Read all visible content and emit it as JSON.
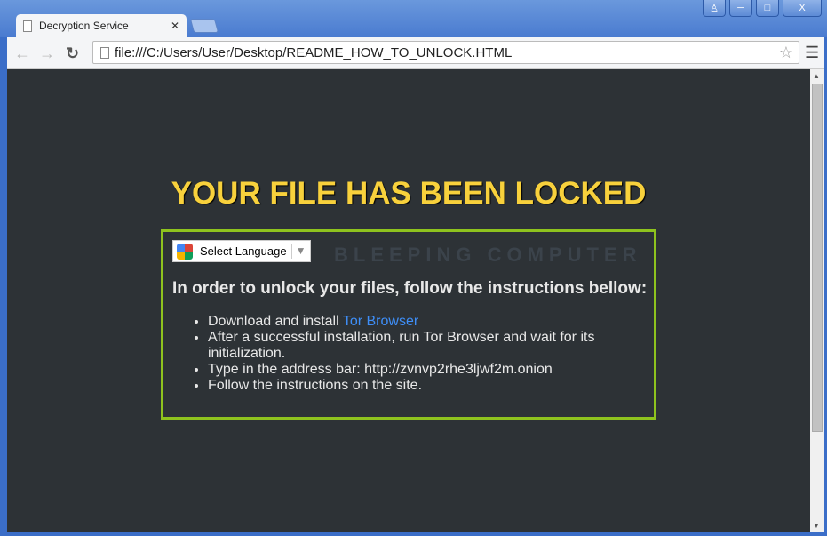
{
  "browser": {
    "tab_title": "Decryption Service",
    "url": "file:///C:/Users/User/Desktop/README_HOW_TO_UNLOCK.HTML"
  },
  "page": {
    "heading": "YOUR FILE HAS BEEN LOCKED",
    "select_language": "Select Language",
    "watermark": "BLEEPING COMPUTER",
    "instructions_title": "In order to unlock your files, follow the instructions bellow:",
    "steps": [
      {
        "text": "Download and install ",
        "link": "Tor Browser"
      },
      {
        "text": "After a successful installation, run Tor Browser and wait for its initialization."
      },
      {
        "text": "Type in the address bar: http://zvnvp2rhe3ljwf2m.onion"
      },
      {
        "text": "Follow the instructions on the site."
      }
    ]
  },
  "colors": {
    "heading": "#f8d13c",
    "border": "#8ec31e",
    "link": "#3e8ef7",
    "background": "#2d3236"
  }
}
